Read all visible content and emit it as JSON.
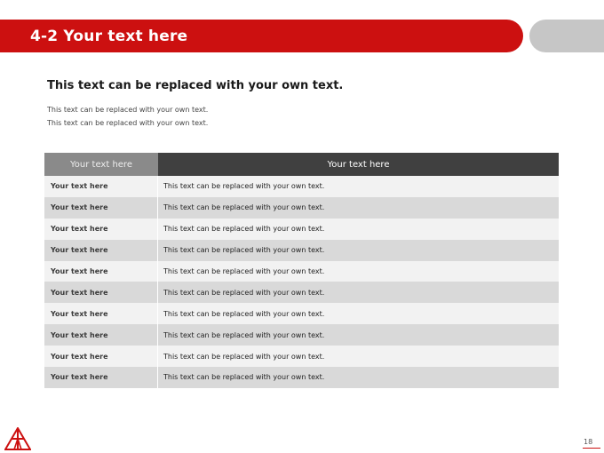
{
  "header": {
    "title": "4-2 Your text here",
    "accent_color": "#cc1010",
    "pill_color": "#c6c6c6"
  },
  "content": {
    "heading": "This text can be replaced with your own text.",
    "subtext": [
      "This text can be replaced with your own text.",
      "This text can be replaced with your own text."
    ]
  },
  "table": {
    "headers": [
      "Your text here",
      "Your text here"
    ],
    "rows": [
      [
        "Your text here",
        "This text can be replaced with your own text."
      ],
      [
        "Your text here",
        "This text can be replaced with your own text."
      ],
      [
        "Your text here",
        "This text can be replaced with your own text."
      ],
      [
        "Your text here",
        "This text can be replaced with your own text."
      ],
      [
        "Your text here",
        "This text can be replaced with your own text."
      ],
      [
        "Your text here",
        "This text can be replaced with your own text."
      ],
      [
        "Your text here",
        "This text can be replaced with your own text."
      ],
      [
        "Your text here",
        "This text can be replaced with your own text."
      ],
      [
        "Your text here",
        "This text can be replaced with your own text."
      ],
      [
        "Your text here",
        "This text can be replaced with your own text."
      ]
    ]
  },
  "footer": {
    "page_number": "18",
    "logo_icon": "red-triangle-logo-icon"
  }
}
